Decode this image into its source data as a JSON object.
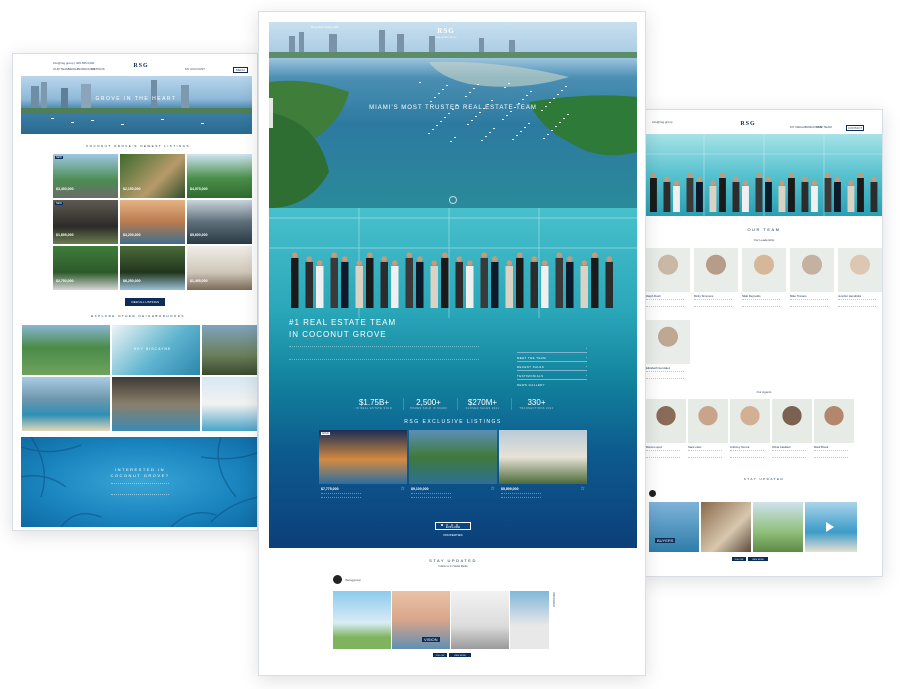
{
  "left_page": {
    "topbar_contact": "info@rsg.group | 305.555.0100",
    "nav_left": [
      "OUR TEAM",
      "NEIGHBORHOODS",
      "LISTINGS"
    ],
    "logo": "RSG",
    "nav_right": [
      "MY ACCOUNT",
      "MENU"
    ],
    "hero_title": "GROVE IN THE HEART",
    "section_listings_title": "COCONUT GROVE'S NEWEST LISTINGS",
    "listing_badge": "NEW",
    "listing_prices": [
      "$3,450,000",
      "$2,150,000",
      "$4,975,000",
      "$1,895,000",
      "$3,200,000",
      "$5,600,000",
      "$2,750,000",
      "$6,250,000",
      "$1,495,000"
    ],
    "view_all_label": "VIEW ALL LISTINGS",
    "section_neighborhoods_title": "EXPLORE OTHER NEIGHBORHOODS",
    "neighborhood_label": "KEY BISCAYNE",
    "interest_title_1": "INTERESTED IN",
    "interest_title_2": "COCONUT GROVE?"
  },
  "center_page": {
    "topbar_phone": "Reynolds Group 305",
    "logo": "RSG",
    "logo_sub": "REAL ESTATE GROUP",
    "hero_title": "MIAMI'S MOST TRUSTED REAL ESTATE TEAM",
    "team_title_1": "#1 REAL ESTATE TEAM",
    "team_title_2": "IN COCONUT GROVE",
    "side_links": [
      "MEET THE TEAM",
      "RECENT SALES",
      "TESTIMONIALS",
      "NEWS GALLERY"
    ],
    "stats": [
      {
        "value": "$1.75B+",
        "label": "IN REAL ESTATE SOLD"
      },
      {
        "value": "2,500+",
        "label": "HOMES SOLD IN MIAMI"
      },
      {
        "value": "$270M+",
        "label": "CLOSED SALES 2021"
      },
      {
        "value": "330+",
        "label": "TRANSACTIONS 2021"
      }
    ],
    "exclusive_title": "RSG EXCLUSIVE LISTINGS",
    "exclusive_badge": "SOLD",
    "exclusive_prices": [
      "$7,775,000",
      "$9,100,000",
      "$5,899,000"
    ],
    "explore_btn": "EXPLORE PROPERTIES",
    "stay_title": "STAY UPDATED",
    "stay_sub": "Follow us on Social Media",
    "insta_handle": "thersggroup",
    "vision_word": "VISION",
    "side_tab": "INSTAGRAM",
    "insta_buttons": [
      "FOLLOW",
      "VIEW MORE"
    ]
  },
  "right_page": {
    "topbar_contact": "info@rsg.group",
    "logo": "RSG",
    "nav_right": [
      "MY NEIGHBORHOODS",
      "OUR TEAM",
      "ABOUT",
      "CONTACT"
    ],
    "team_title": "OUR TEAM",
    "leadership_title": "Our Leadership",
    "leaders": [
      "Ralph Dosh",
      "Ricky Simmons",
      "Nikki Reynolds",
      "Mike Trimano",
      "Jennifer Hendricks",
      "Elizabeth Gonzalez"
    ],
    "agents_title": "Our Agents",
    "agents": [
      "Marco Lopez",
      "Sara Lister",
      "Anthony Scurra",
      "Olivia Caldwell",
      "Mark Brook",
      "Dana Hart"
    ],
    "stay_title": "STAY UPDATED",
    "buyers_word": "BUYERS",
    "insta_buttons": [
      "FOLLOW",
      "VIEW MORE"
    ]
  },
  "colors": {
    "navy": "#0c2d57",
    "teal": "#1f8aa8",
    "ocean": "#1d6fa3",
    "white": "#ffffff"
  }
}
